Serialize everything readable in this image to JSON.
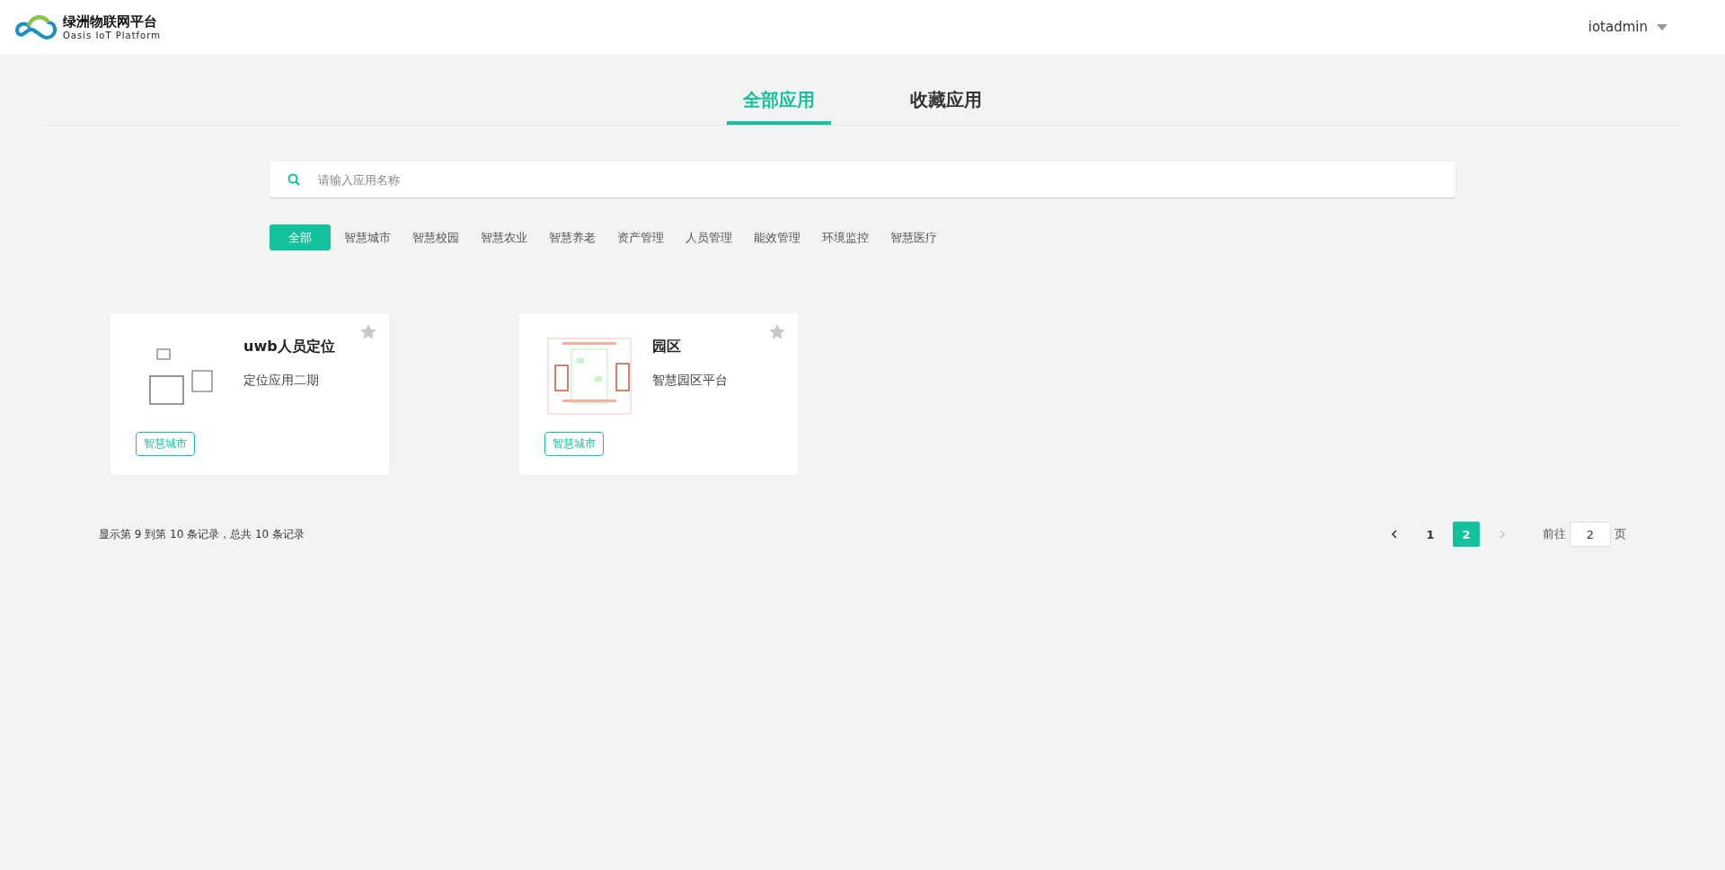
{
  "header": {
    "logo_title": "绿洲物联网平台",
    "logo_subtitle": "Oasis IoT Platform",
    "user": "iotadmin"
  },
  "tabs": [
    {
      "label": "全部应用",
      "selected": true
    },
    {
      "label": "收藏应用",
      "selected": false
    }
  ],
  "search": {
    "placeholder": "请输入应用名称"
  },
  "categories": [
    {
      "label": "全部",
      "selected": true
    },
    {
      "label": "智慧城市",
      "selected": false
    },
    {
      "label": "智慧校园",
      "selected": false
    },
    {
      "label": "智慧农业",
      "selected": false
    },
    {
      "label": "智慧养老",
      "selected": false
    },
    {
      "label": "资产管理",
      "selected": false
    },
    {
      "label": "人员管理",
      "selected": false
    },
    {
      "label": "能效管理",
      "selected": false
    },
    {
      "label": "环境监控",
      "selected": false
    },
    {
      "label": "智慧医疗",
      "selected": false
    }
  ],
  "apps": [
    {
      "name": "uwb人员定位",
      "description": "定位应用二期",
      "tag": "智慧城市",
      "favorite": false
    },
    {
      "name": "园区",
      "description": "智慧园区平台",
      "tag": "智慧城市",
      "favorite": false
    }
  ],
  "pagination": {
    "summary": "显示第 9 到第 10 条记录，总共 10 条记录",
    "prev_disabled": false,
    "next_disabled": true,
    "pages": [
      {
        "label": "1",
        "selected": false
      },
      {
        "label": "2",
        "selected": true
      }
    ],
    "goto_label": "前往",
    "goto_value": "2",
    "goto_unit": "页"
  }
}
